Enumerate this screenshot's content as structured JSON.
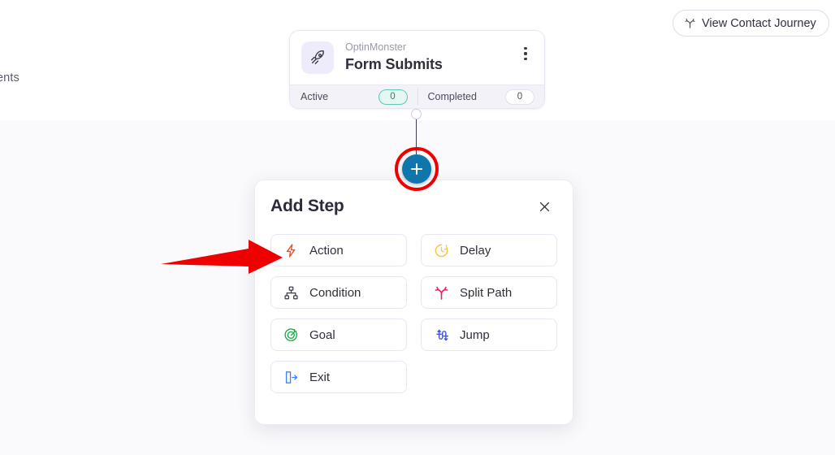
{
  "page": {
    "background_color": "#fafafc",
    "clipped_sidebar_text": "ents"
  },
  "header": {
    "journey_button": {
      "label": "View Contact Journey",
      "icon": "split-path-icon"
    }
  },
  "trigger_card": {
    "icon": "rocket-icon",
    "subtitle": "OptinMonster",
    "title": "Form Submits",
    "menu_icon": "kebab-menu-icon",
    "stats": [
      {
        "label": "Active",
        "value": "0",
        "accent": "#5fc9b4"
      },
      {
        "label": "Completed",
        "value": "0",
        "accent": "#e2e1ec"
      }
    ]
  },
  "add_node_button": {
    "icon": "plus-icon",
    "color": "#0f76ab",
    "annotation_ring_color": "#ee0000"
  },
  "add_step_panel": {
    "title": "Add Step",
    "close_icon": "close-icon",
    "options": [
      {
        "label": "Action",
        "icon": "lightning-bolt-icon",
        "color": "#f04a25"
      },
      {
        "label": "Delay",
        "icon": "clock-icon",
        "color": "#f6c344"
      },
      {
        "label": "Condition",
        "icon": "sitemap-icon",
        "color": "#3c3c4a"
      },
      {
        "label": "Split Path",
        "icon": "split-path-icon",
        "color": "#e81f63"
      },
      {
        "label": "Goal",
        "icon": "target-goal-icon",
        "color": "#21a84a"
      },
      {
        "label": "Jump",
        "icon": "jump-arrows-icon",
        "color": "#4854d6"
      },
      {
        "label": "Exit",
        "icon": "exit-door-icon",
        "color": "#3b82f6"
      }
    ]
  },
  "annotations": {
    "arrow": {
      "color": "#ee0000",
      "points_to": "Action",
      "direction": "right"
    }
  }
}
